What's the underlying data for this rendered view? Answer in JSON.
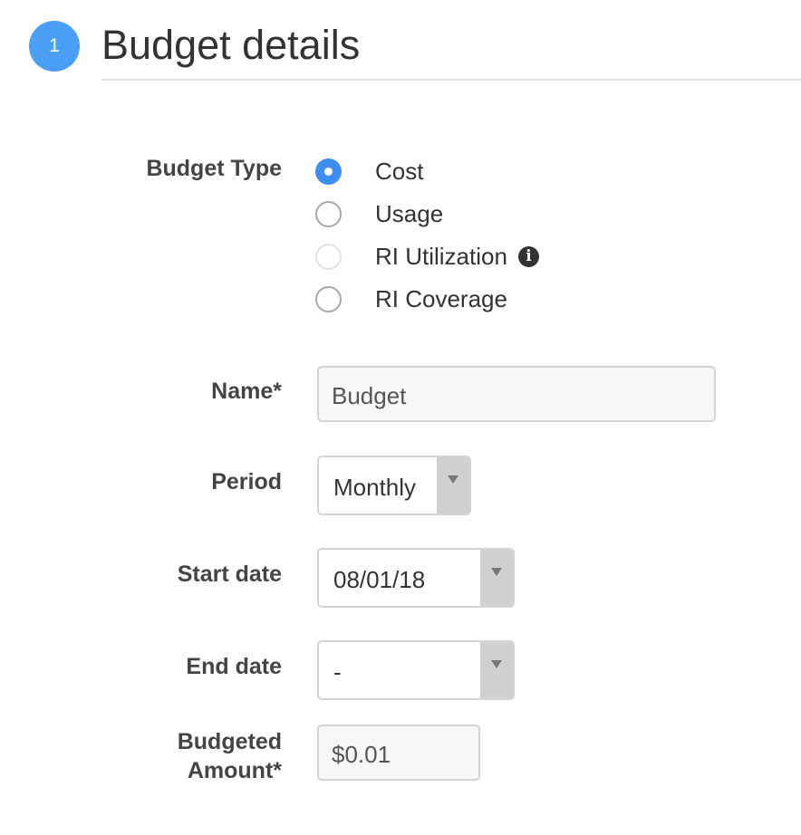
{
  "section": {
    "step_number": "1",
    "title": "Budget details"
  },
  "budget_type": {
    "label": "Budget Type",
    "options": [
      {
        "label": "Cost",
        "state": "checked"
      },
      {
        "label": "Usage",
        "state": "unchecked"
      },
      {
        "label": "RI Utilization",
        "state": "disabled",
        "info_icon": "info-icon"
      },
      {
        "label": "RI Coverage",
        "state": "unchecked"
      }
    ]
  },
  "name": {
    "label": "Name*",
    "value": "Budget"
  },
  "period": {
    "label": "Period",
    "value": "Monthly"
  },
  "start_date": {
    "label": "Start date",
    "value": "08/01/18"
  },
  "end_date": {
    "label": "End date",
    "value": "-"
  },
  "budgeted_amount": {
    "label_line1": "Budgeted",
    "label_line2": "Amount*",
    "value": "$0.01"
  },
  "colors": {
    "accent": "#3d8ef2",
    "step_circle": "#4a9ff5",
    "dropdown_caret_bg": "#d0d0d0"
  }
}
